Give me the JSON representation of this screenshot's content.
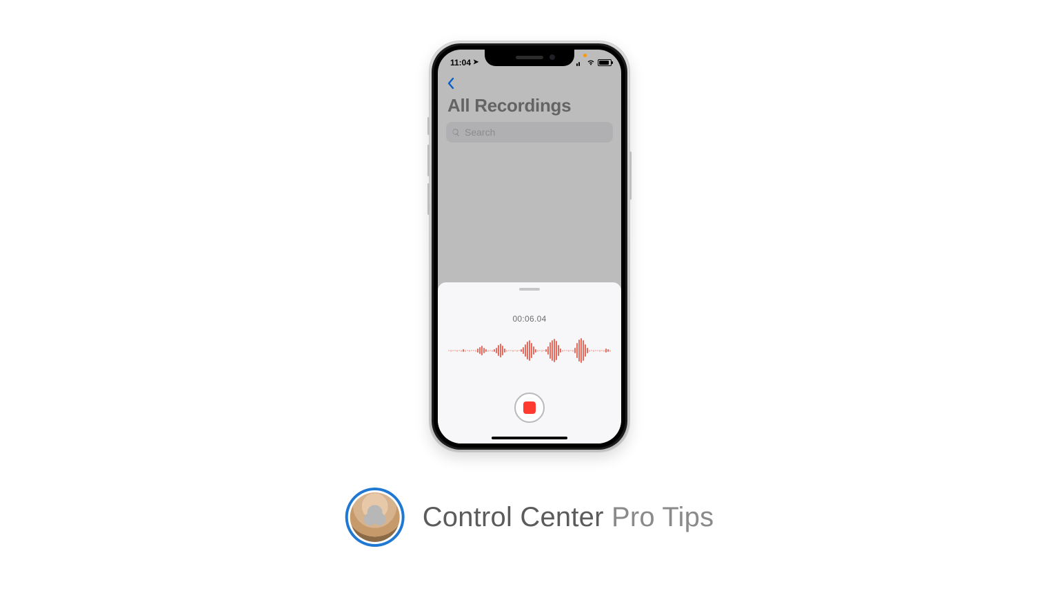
{
  "status": {
    "time": "11:04",
    "location_arrow": "➤"
  },
  "nav": {
    "title": "All Recordings"
  },
  "search": {
    "placeholder": "Search"
  },
  "recording": {
    "timer": "00:06.04",
    "waveform": [
      2,
      3,
      2,
      2,
      3,
      2,
      3,
      4,
      3,
      2,
      3,
      2,
      2,
      3,
      6,
      10,
      14,
      8,
      4,
      3,
      2,
      3,
      4,
      8,
      16,
      20,
      14,
      6,
      3,
      2,
      2,
      3,
      2,
      3,
      2,
      4,
      10,
      18,
      26,
      30,
      22,
      12,
      5,
      3,
      2,
      3,
      2,
      4,
      12,
      24,
      30,
      34,
      28,
      16,
      6,
      3,
      2,
      2,
      3,
      2,
      3,
      8,
      22,
      32,
      36,
      30,
      18,
      8,
      3,
      2,
      3,
      2,
      2,
      3,
      2,
      3,
      6,
      4,
      3
    ]
  },
  "caption": {
    "strong": "Control Center",
    "light": "Pro Tips"
  }
}
